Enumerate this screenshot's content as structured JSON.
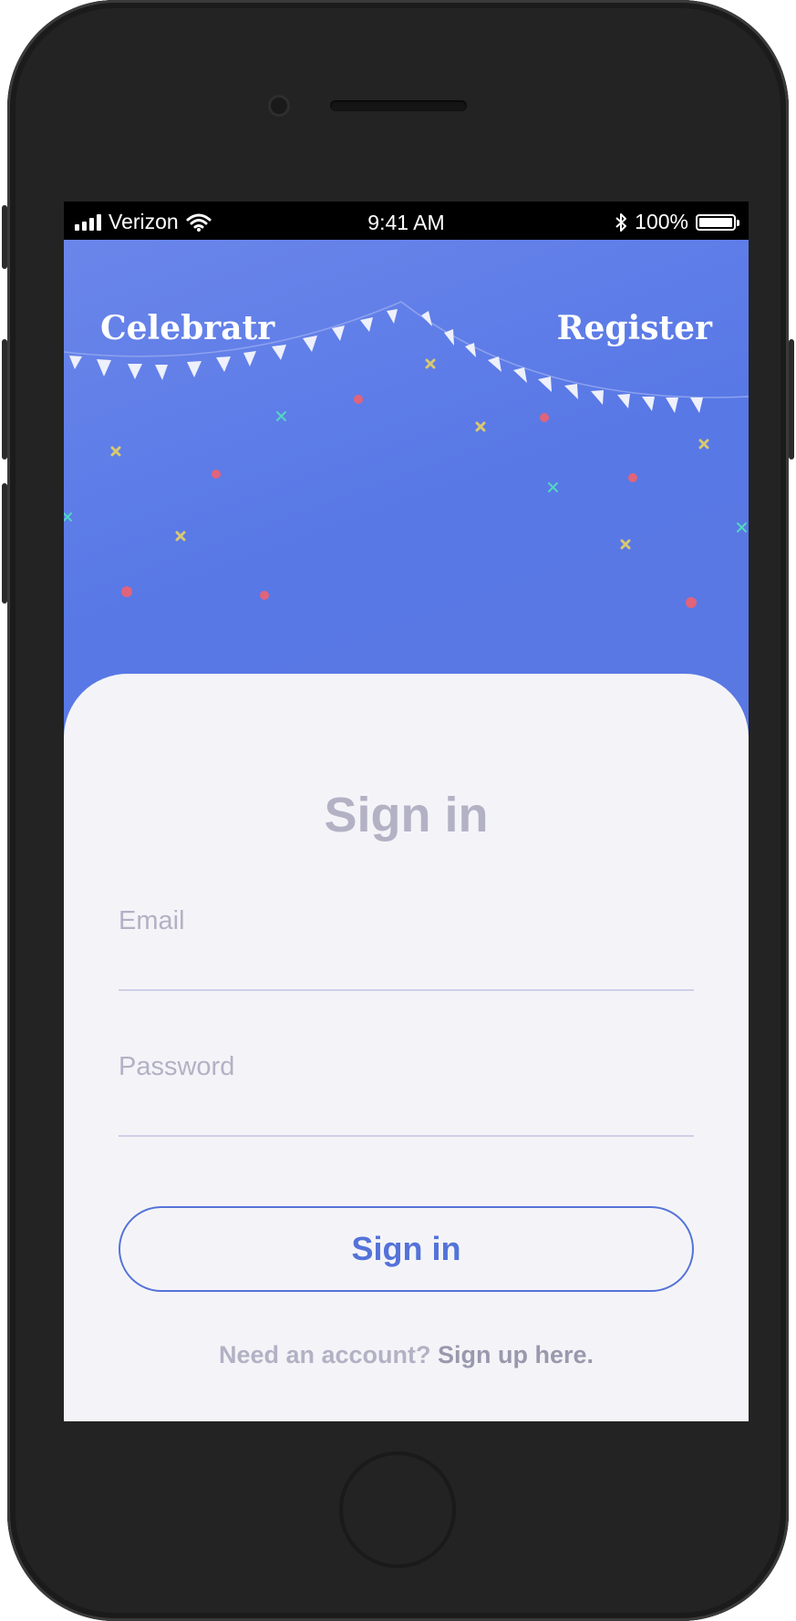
{
  "status_bar": {
    "carrier": "Verizon",
    "time": "9:41 AM",
    "battery_percent": "100%",
    "battery_level": 1.0,
    "icons": [
      "signal-bars-icon",
      "wifi-icon",
      "bluetooth-icon",
      "battery-icon"
    ]
  },
  "header": {
    "brand": "Celebratr",
    "register_label": "Register"
  },
  "signin": {
    "title": "Sign in",
    "email_label": "Email",
    "email_value": "",
    "password_label": "Password",
    "password_value": "",
    "button_label": "Sign in",
    "footer_prompt": "Need an account?",
    "footer_link": "Sign up here."
  },
  "colors": {
    "hero_blue": "#5a78e4",
    "accent": "#5472d9",
    "card_bg": "#f4f4f8",
    "muted_text": "#b3b1c4",
    "confetti_red": "#e0647a",
    "confetti_gold": "#d9c870",
    "confetti_teal": "#53d6c3"
  }
}
